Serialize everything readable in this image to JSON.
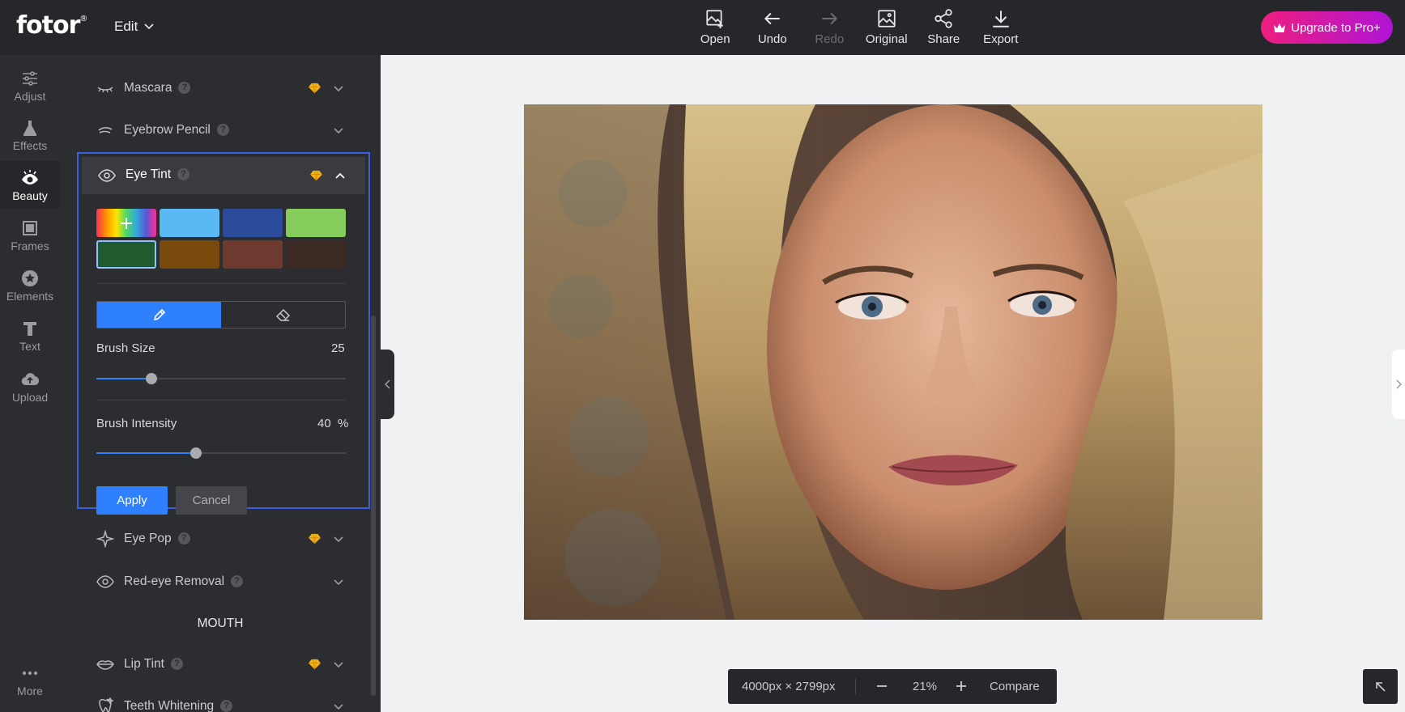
{
  "app": {
    "logo": "fotor",
    "logo_mark": "®",
    "edit_menu": "Edit"
  },
  "toolbar": [
    {
      "label": "Open",
      "icon": "image-plus-icon"
    },
    {
      "label": "Undo",
      "icon": "arrow-left-icon"
    },
    {
      "label": "Redo",
      "icon": "arrow-right-icon"
    },
    {
      "label": "Original",
      "icon": "image-icon"
    },
    {
      "label": "Share",
      "icon": "share-icon"
    },
    {
      "label": "Export",
      "icon": "download-icon"
    }
  ],
  "upgrade_label": "Upgrade to Pro+",
  "sidebar": {
    "items": [
      {
        "label": "Adjust",
        "icon": "sliders-icon"
      },
      {
        "label": "Effects",
        "icon": "flask-icon"
      },
      {
        "label": "Beauty",
        "icon": "eye-icon"
      },
      {
        "label": "Frames",
        "icon": "frame-icon"
      },
      {
        "label": "Elements",
        "icon": "star-icon"
      },
      {
        "label": "Text",
        "icon": "text-icon"
      },
      {
        "label": "Upload",
        "icon": "cloud-upload-icon"
      }
    ],
    "more": "More"
  },
  "panel": {
    "mascara": "Mascara",
    "eyebrow": "Eyebrow Pencil",
    "eye_tint": "Eye Tint",
    "brush_size_label": "Brush Size",
    "brush_size_value": "25",
    "brush_size_level": 0.22,
    "brush_intensity_label": "Brush Intensity",
    "brush_intensity_value": "40",
    "brush_intensity_unit": "%",
    "brush_intensity_level": 0.4,
    "apply": "Apply",
    "cancel": "Cancel",
    "eye_pop": "Eye Pop",
    "red_eye": "Red-eye Removal",
    "mouth_section": "MOUTH",
    "lip_tint": "Lip Tint",
    "teeth": "Teeth Whitening",
    "help": "?",
    "swatches": [
      "rainbow",
      "#5ab8f5",
      "#2b4a9a",
      "#86cc5c",
      "#215a2c",
      "#7a4a0c",
      "#6e3a30",
      "#3d2a24"
    ]
  },
  "zoom": {
    "dimensions": "4000px × 2799px",
    "percent": "21%",
    "compare": "Compare"
  }
}
